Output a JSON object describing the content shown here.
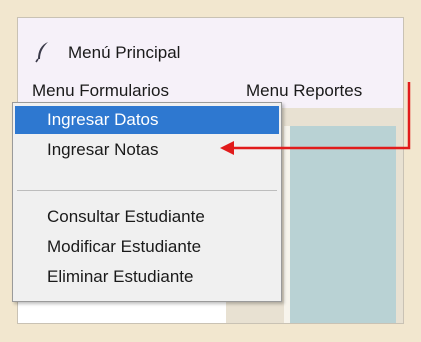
{
  "window": {
    "title": "Menú Principal"
  },
  "menubar": {
    "items": [
      {
        "label": "Menu Formularios"
      },
      {
        "label": "Menu Reportes"
      }
    ]
  },
  "dropdown": {
    "group1": [
      {
        "label": "Ingresar Datos",
        "selected": true
      },
      {
        "label": "Ingresar Notas",
        "selected": false
      }
    ],
    "group2": [
      {
        "label": "Consultar Estudiante"
      },
      {
        "label": "Modificar Estudiante"
      },
      {
        "label": "Eliminar Estudiante"
      }
    ]
  },
  "colors": {
    "selection": "#2e78d0",
    "annotation": "#e11b1b",
    "frame": "#f2e7cf"
  },
  "icons": {
    "app_icon": "feather-icon",
    "annotation_arrow": "arrow-left-icon"
  }
}
